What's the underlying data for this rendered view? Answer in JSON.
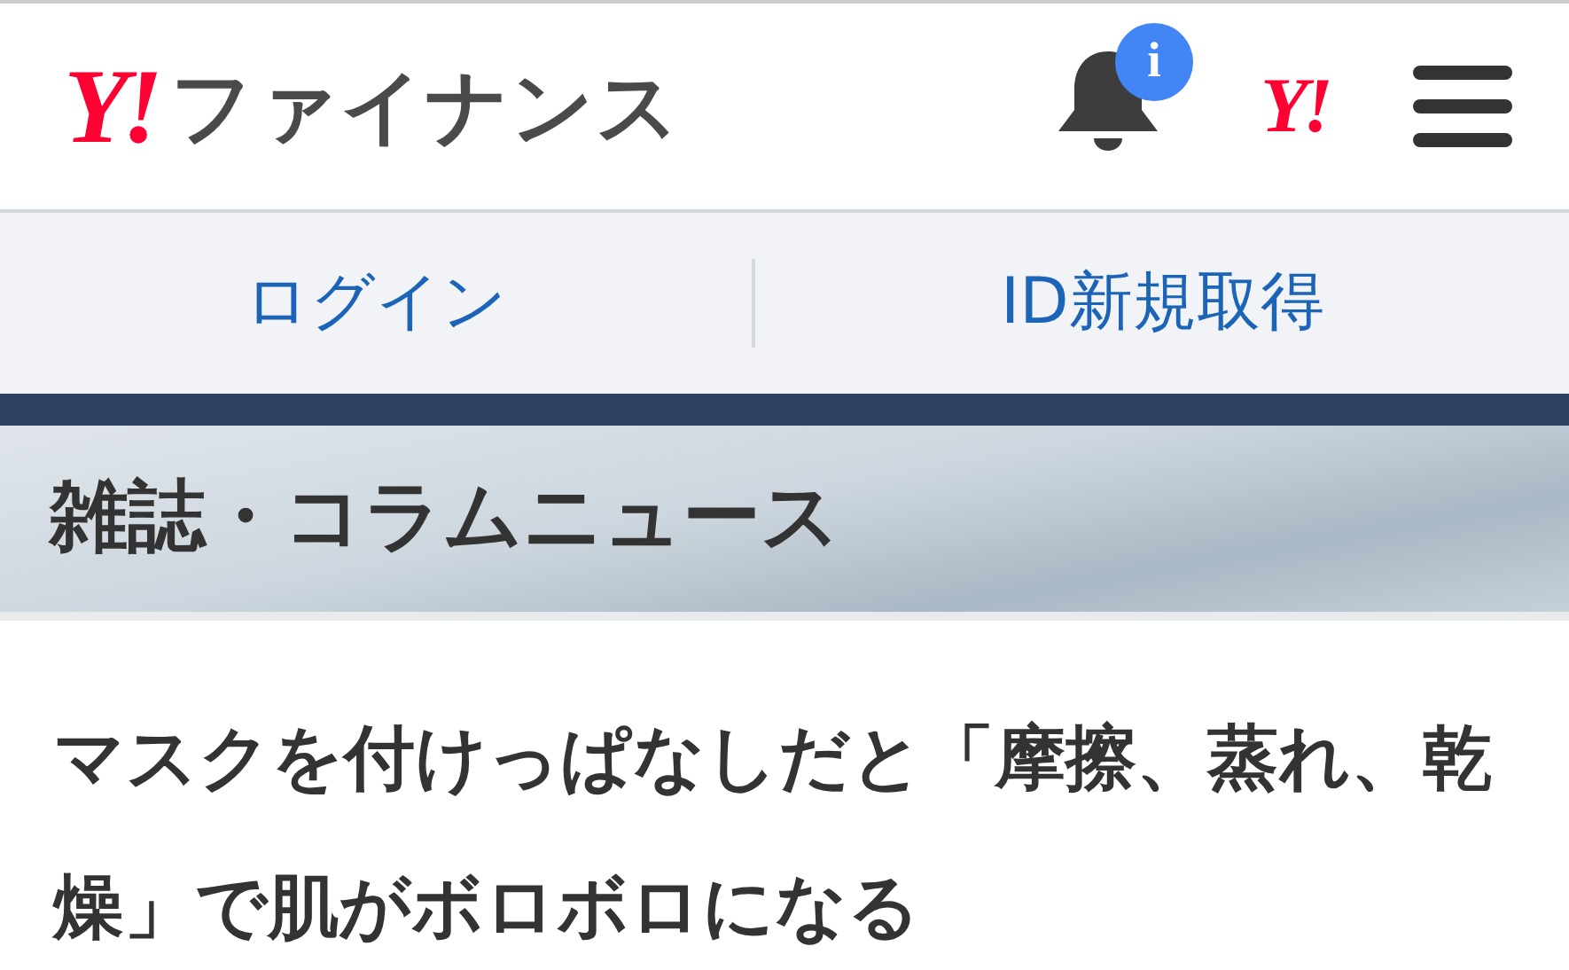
{
  "header": {
    "logo_mark": "Y!",
    "logo_text": "ファイナンス",
    "notification_badge": "i",
    "yahoo_mark": "Y!"
  },
  "account_links": [
    {
      "label": "ログイン"
    },
    {
      "label": "ID新規取得"
    }
  ],
  "section": {
    "title": "雑誌・コラムニュース"
  },
  "article": {
    "title": "マスクを付けっぱなしだと「摩擦、蒸れ、乾燥」で肌がボロボロになる"
  }
}
